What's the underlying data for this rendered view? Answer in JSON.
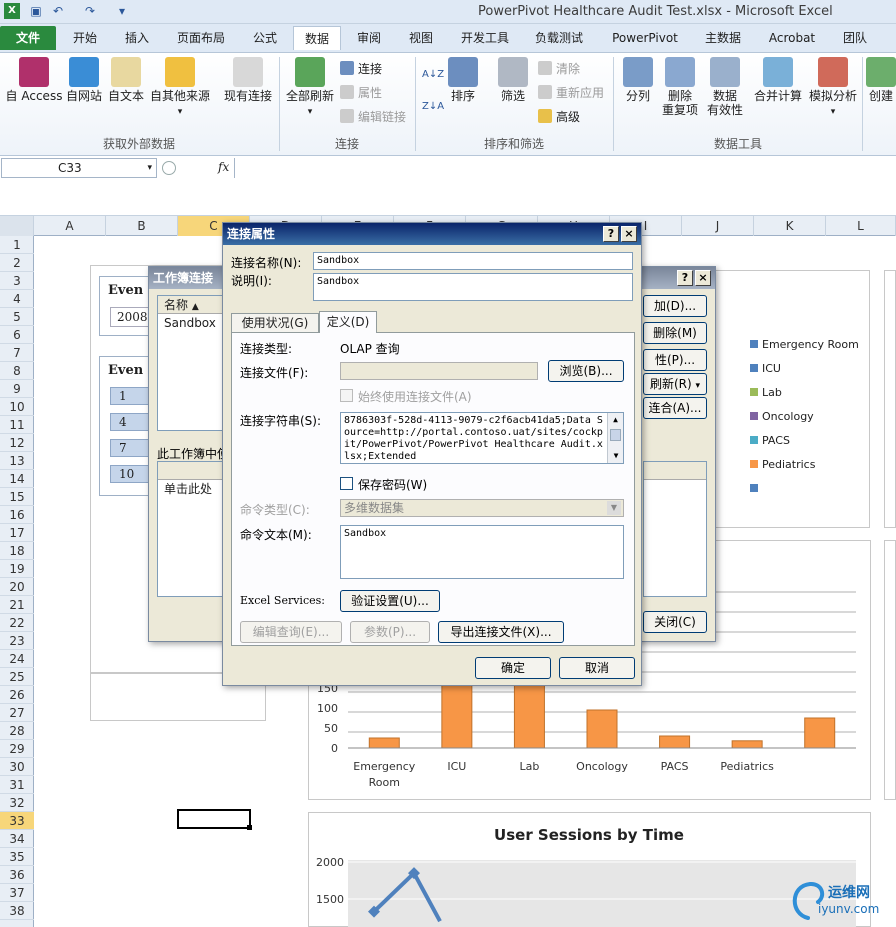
{
  "window": {
    "title": "PowerPivot Healthcare Audit Test.xlsx - Microsoft Excel"
  },
  "tabs": [
    "文件",
    "开始",
    "插入",
    "页面布局",
    "公式",
    "数据",
    "审阅",
    "视图",
    "开发工具",
    "负载测试",
    "PowerPivot",
    "主数据",
    "Acrobat",
    "团队"
  ],
  "ribbon": {
    "ext_data": {
      "access": "自 Access",
      "web": "自网站",
      "text": "自文本",
      "other": "自其他来源",
      "existing": "现有连接",
      "group": "获取外部数据"
    },
    "connections": {
      "refresh_all": "全部刷新",
      "connections": "连接",
      "properties": "属性",
      "edit_links": "编辑链接",
      "group": "连接"
    },
    "sort_filter": {
      "sort": "排序",
      "filter": "筛选",
      "clear": "清除",
      "reapply": "重新应用",
      "advanced": "高级",
      "group": "排序和筛选"
    },
    "data_tools": {
      "split": "分列",
      "remove_dup_1": "删除",
      "remove_dup_2": "重复项",
      "validation_1": "数据",
      "validation_2": "有效性",
      "consolidate": "合并计算",
      "whatif": "模拟分析",
      "create": "创建",
      "group": "数据工具"
    }
  },
  "formula_bar": {
    "name_box": "C33",
    "fx": "fx"
  },
  "columns": [
    "A",
    "B",
    "C",
    "D",
    "E",
    "F",
    "G",
    "H",
    "I",
    "J",
    "K",
    "L"
  ],
  "rows": [
    "1",
    "2",
    "3",
    "4",
    "5",
    "6",
    "7",
    "8",
    "9",
    "10",
    "11",
    "12",
    "13",
    "14",
    "15",
    "16",
    "17",
    "18",
    "19",
    "20",
    "21",
    "22",
    "23",
    "24",
    "25",
    "26",
    "27",
    "28",
    "29",
    "30",
    "31",
    "32",
    "33",
    "34",
    "35",
    "36",
    "37",
    "38"
  ],
  "slicer": {
    "title1": "Even",
    "year": "2008",
    "title2": "Even",
    "items": [
      "1",
      "4",
      "7",
      "10"
    ]
  },
  "legend": [
    {
      "label": "Emergency Room",
      "color": "#4f81bd"
    },
    {
      "label": "ICU",
      "color": "#4f81bd"
    },
    {
      "label": "Lab",
      "color": "#9bbb59"
    },
    {
      "label": "Oncology",
      "color": "#8064a2"
    },
    {
      "label": "PACS",
      "color": "#4bacc6"
    },
    {
      "label": "Pediatrics",
      "color": "#f79646"
    },
    {
      "label": "",
      "color": "#4f81bd"
    }
  ],
  "chart_data": [
    {
      "type": "bar",
      "categories": [
        "Emergency Room",
        "ICU",
        "Lab",
        "Oncology",
        "PACS",
        "Pediatrics",
        ""
      ],
      "values": [
        25,
        160,
        160,
        95,
        30,
        18,
        75
      ],
      "yticks": [
        "0",
        "50",
        "100",
        "150"
      ],
      "ylim": [
        0,
        150
      ]
    },
    {
      "type": "line",
      "title": "User Sessions by Time",
      "yticks": [
        "2000",
        "1500"
      ],
      "x": [
        1,
        2,
        3
      ],
      "values": [
        1330,
        1850,
        1200
      ]
    }
  ],
  "wb_dialog": {
    "title": "工作簿连接",
    "col_name": "名称",
    "item": "Sandbox",
    "section": "此工作簿中使",
    "click_text": "单击此处",
    "btn_add": "加(D)...",
    "btn_remove": "删除(M)",
    "btn_props": "性(P)...",
    "btn_refresh": "刷新(R)",
    "btn_manage": "连合(A)...",
    "btn_close": "关闭(C)",
    "help": "?",
    "close": "×"
  },
  "cp_dialog": {
    "title": "连接属性",
    "help": "?",
    "close": "×",
    "name_label": "连接名称(N):",
    "name_value": "Sandbox",
    "desc_label": "说明(I):",
    "desc_value": "Sandbox",
    "tab_usage": "使用状况(G)",
    "tab_def": "定义(D)",
    "conn_type_label": "连接类型:",
    "conn_type_value": "OLAP 查询",
    "conn_file_label": "连接文件(F):",
    "browse": "浏览(B)...",
    "always_use": "始终使用连接文件(A)",
    "conn_str_label": "连接字符串(S):",
    "conn_str": "8786303f-528d-4113-9079-c2f6acb41da5;Data Source=http://portal.contoso.uat/sites/cockpit/PowerPivot/PowerPivot Healthcare Audit.xlsx;Extended",
    "save_pwd": "保存密码(W)",
    "cmd_type_label": "命令类型(C):",
    "cmd_type_value": "多维数据集",
    "cmd_text_label": "命令文本(M):",
    "cmd_text_value": "Sandbox",
    "excel_services": "Excel Services:",
    "auth": "验证设置(U)...",
    "edit_query": "编辑查询(E)...",
    "params": "参数(P)...",
    "export": "导出连接文件(X)...",
    "ok": "确定",
    "cancel": "取消"
  },
  "watermark": {
    "text": "运维网",
    "sub": "iyunv.com"
  }
}
